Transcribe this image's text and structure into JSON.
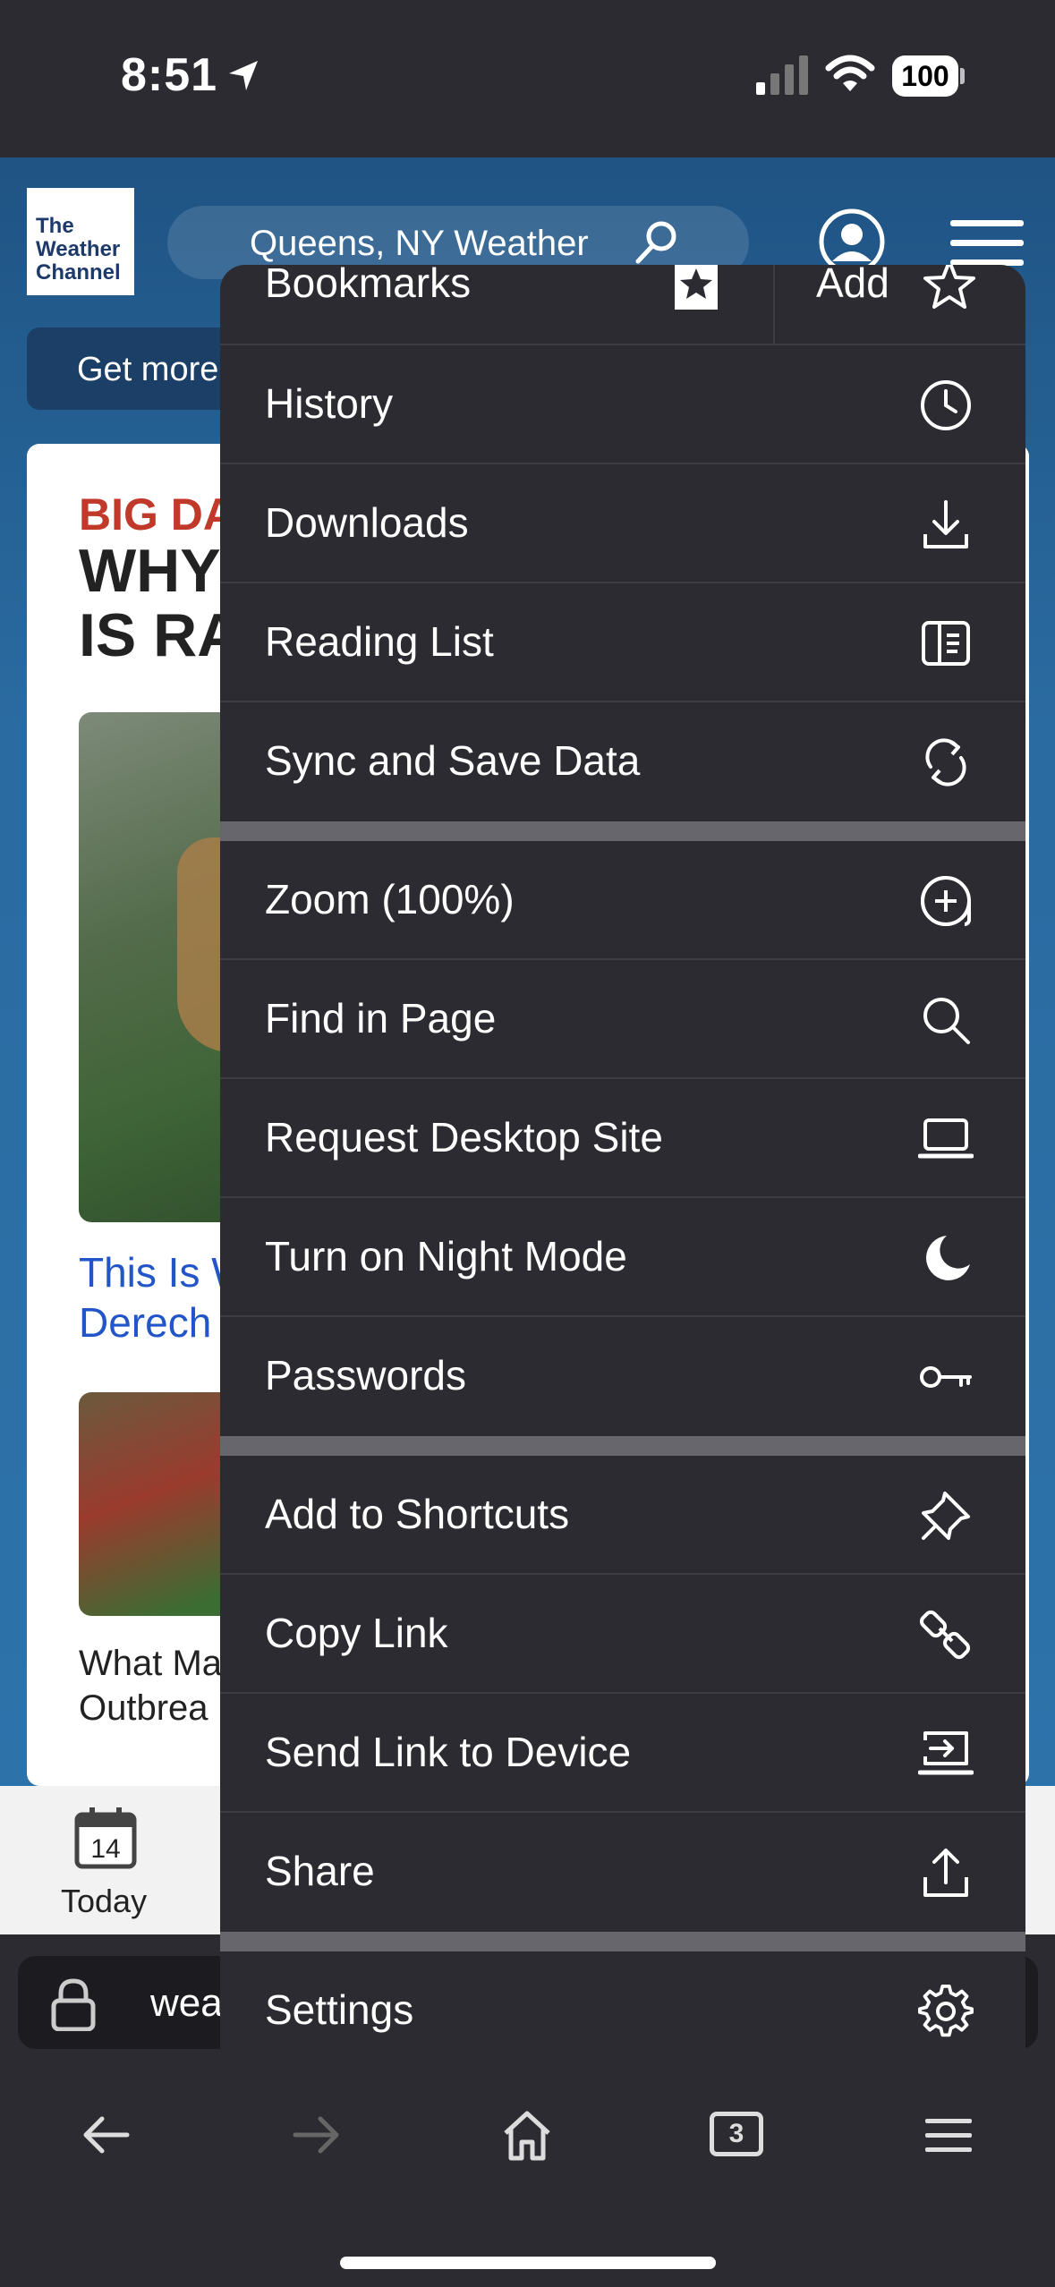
{
  "status": {
    "time": "8:51",
    "battery": "100"
  },
  "site": {
    "logo_lines": [
      "The",
      "Weather",
      "Channel"
    ],
    "search_text": "Queens, NY Weather",
    "get_more": "Get more",
    "headline_kicker": "BIG DA",
    "headline_lines": [
      "WHY",
      "IS RA"
    ],
    "link_lines": [
      "This Is W",
      "Derech"
    ],
    "story2_lines": [
      "What Ma",
      "Outbrea"
    ],
    "tab_today": "Today",
    "calendar_day": "14"
  },
  "url_bar": {
    "text": "wea"
  },
  "bottom_nav": {
    "tabs_count": "3"
  },
  "menu": {
    "bookmarks": "Bookmarks",
    "add": "Add",
    "group1": [
      {
        "label": "History",
        "icon": "clock-icon"
      },
      {
        "label": "Downloads",
        "icon": "download-icon"
      },
      {
        "label": "Reading List",
        "icon": "reading-list-icon"
      },
      {
        "label": "Sync and Save Data",
        "icon": "sync-icon"
      }
    ],
    "group2": [
      {
        "label": "Zoom (100%)",
        "icon": "zoom-in-icon"
      },
      {
        "label": "Find in Page",
        "icon": "search-icon"
      },
      {
        "label": "Request Desktop Site",
        "icon": "laptop-icon"
      },
      {
        "label": "Turn on Night Mode",
        "icon": "moon-icon"
      },
      {
        "label": "Passwords",
        "icon": "key-icon"
      }
    ],
    "group3": [
      {
        "label": "Add to Shortcuts",
        "icon": "pin-icon"
      },
      {
        "label": "Copy Link",
        "icon": "link-icon"
      },
      {
        "label": "Send Link to Device",
        "icon": "send-to-device-icon"
      },
      {
        "label": "Share",
        "icon": "share-icon"
      }
    ],
    "settings": "Settings"
  }
}
